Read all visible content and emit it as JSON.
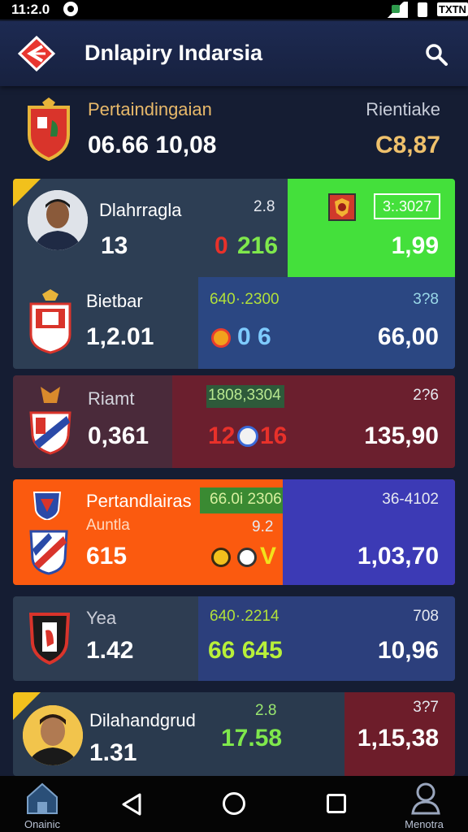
{
  "status_bar": {
    "time": "11:2.0",
    "network": "TXTN"
  },
  "app_bar": {
    "title": "Dnlapiry Indarsia"
  },
  "summary": {
    "label": "Pertaindingaian",
    "value": "06.66 10,08",
    "right_label": "Rientiake",
    "right_value": "C8,87"
  },
  "cards": [
    {
      "name": "Dlahrragla",
      "value": "13",
      "odds_small": "2.8",
      "score_zero": "0",
      "score": "216",
      "tag": "3:.3027",
      "right_value": "1,99",
      "colors": {
        "left": "#2d3e54",
        "right": "#44e03b"
      }
    },
    {
      "name": "Bietbar",
      "value": "1,2.01",
      "range": "640·.2300",
      "odds_small": "3?8",
      "score": "0  6",
      "right_value": "66,00",
      "colors": {
        "left": "#2d3e54",
        "right": "#2b4782"
      }
    },
    {
      "name": "Riamt",
      "value": "0,361",
      "range": "1808,3304",
      "odds_small": "2?6",
      "score_left": "12",
      "score_right": "16",
      "right_value": "135,90",
      "colors": {
        "left": "#4a2a3a",
        "right": "#6b1f2e"
      }
    },
    {
      "name": "Pertandlairas",
      "sub": "Auntla",
      "value": "615",
      "range": "66.0i 2306",
      "odds_small": "9.2",
      "score": "V",
      "right_range": "36-4102",
      "right_value": "1,03,70",
      "colors": {
        "left": "#fb5a0f",
        "right": "#3c3ab5"
      }
    },
    {
      "name": "Yea",
      "value": "1.42",
      "range": "640·.2214",
      "score": "66 645",
      "odds_small": "708",
      "right_value": "10,96",
      "colors": {
        "left": "#2e3d52",
        "right": "#2c3f7c"
      }
    },
    {
      "name": "Dilahandgrud",
      "value": "1.31",
      "odds_small": "2.8",
      "score": "17.58",
      "odds_right": "3?7",
      "right_value": "1,15,38",
      "colors": {
        "left": "#2a3a4e",
        "right": "#6d1d2a"
      }
    }
  ],
  "nav": {
    "home_label": "Onainic",
    "menu_label": "Menotra"
  }
}
